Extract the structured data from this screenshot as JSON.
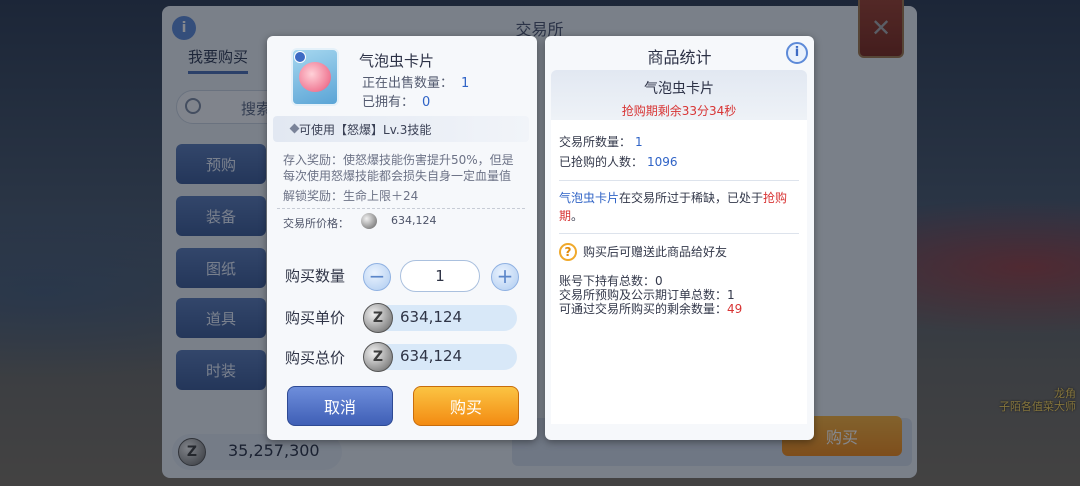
{
  "background": {
    "hint_a": "",
    "hint_b": "龙角",
    "hint_c": "子陌各值菜大师"
  },
  "exchange": {
    "title": "交易所",
    "info_icon": "i",
    "tab_buy": "我要购买",
    "search_placeholder": "搜索",
    "categories": [
      "预购",
      "装备",
      "图纸",
      "道具",
      "时装"
    ],
    "coin_icon": "Z",
    "balance": "35,257,300",
    "buy_button": "购买",
    "close_icon": "✕"
  },
  "purchase": {
    "item_name": "气泡虫卡片",
    "on_sale_label": "正在出售数量：",
    "on_sale_value": "1",
    "owned_label": "已拥有：",
    "owned_value": "0",
    "skill_prefix": "可使用【",
    "skill_name": "怒爆",
    "skill_suffix": "】Lv.3技能",
    "deposit_reward": "存入奖励：使怒爆技能伤害提升50%，但是每次使用怒爆技能都会损失自身一定血量值",
    "unlock_reward": "解锁奖励：生命上限＋24",
    "exchange_price_label": "交易所价格：",
    "exchange_price_value": "634,124",
    "qty_label": "购买数量",
    "qty_minus": "−",
    "qty_value": "1",
    "qty_plus": "+",
    "unit_price_label": "购买单价",
    "unit_price_value": "634,124",
    "total_price_label": "购买总价",
    "total_price_value": "634,124",
    "coin_icon": "Z",
    "cancel_button": "取消",
    "buy_button": "购买"
  },
  "stats": {
    "title": "商品统计",
    "info_icon": "i",
    "item_name": "气泡虫卡片",
    "countdown": "抢购期剩余33分34秒",
    "exchange_count_label": "交易所数量：",
    "exchange_count_value": "1",
    "grabbed_label": "已抢购的人数：",
    "grabbed_value": "1096",
    "scarce_item": "气泡虫卡片",
    "scarce_text": "在交易所过于稀缺，已处于",
    "scarce_state": "抢购期",
    "scarce_end": "。",
    "gift_icon": "?",
    "gift_text": "购买后可赠送此商品给好友",
    "held_label": "账号下持有总数：",
    "held_value": "0",
    "preorders_label": "交易所预购及公示期订单总数：",
    "preorders_value": "1",
    "remaining_label": "可通过交易所购买的剩余数量：",
    "remaining_value": "49"
  }
}
